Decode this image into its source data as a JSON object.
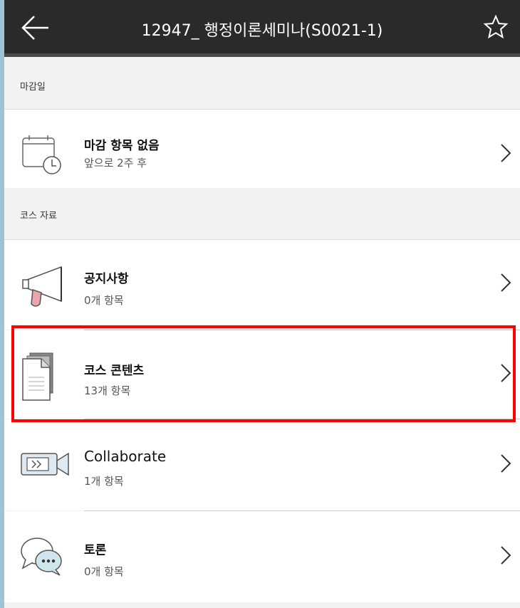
{
  "header": {
    "title": "12947_ 행정이론세미나(S0021-1)"
  },
  "sections": [
    {
      "label": "마감일"
    },
    {
      "label": "코스 자료"
    }
  ],
  "due": {
    "title": "마감 항목 없음",
    "subtitle": "앞으로 2주 후"
  },
  "items": [
    {
      "title": "공지사항",
      "count": "0개 항목",
      "icon": "megaphone-icon"
    },
    {
      "title": "코스 콘텐츠",
      "count": "13개 항목",
      "icon": "document-icon"
    },
    {
      "title": "Collaborate",
      "count": "1개 항목",
      "icon": "video-icon"
    },
    {
      "title": "토론",
      "count": "0개 항목",
      "icon": "chat-icon"
    }
  ],
  "colors": {
    "header": "#2a2a2a",
    "highlight": "#ff0000",
    "background": "#f2f2f2"
  }
}
